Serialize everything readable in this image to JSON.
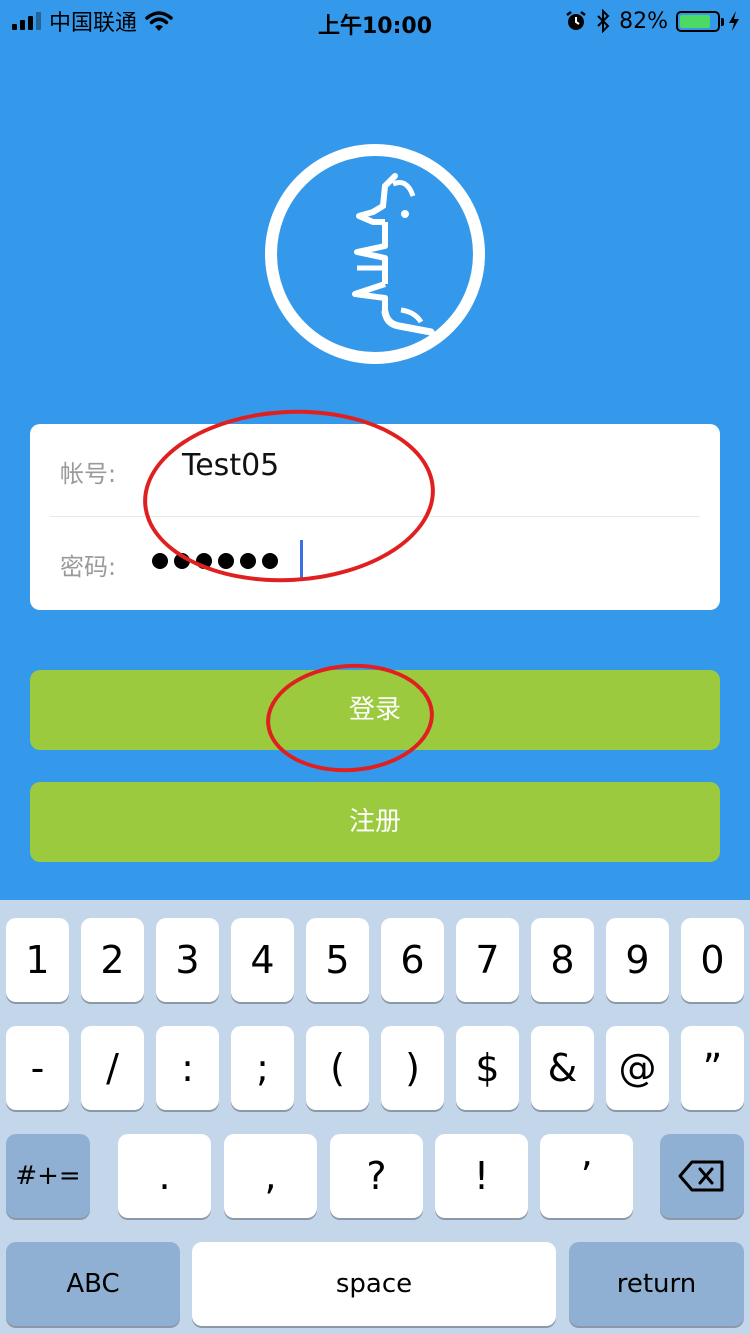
{
  "status_bar": {
    "carrier": "中国联通",
    "time": "上午10:00",
    "battery_percent": "82%",
    "battery_level": 0.82,
    "icons": [
      "signal-icon",
      "wifi-icon",
      "alarm-icon",
      "bluetooth-icon",
      "battery-icon",
      "charging-icon"
    ]
  },
  "logo": {
    "icon": "mongolian-script-logo"
  },
  "form": {
    "account_label": "帐号:",
    "account_value": "Test05",
    "password_label": "密码:",
    "password_length": 6
  },
  "buttons": {
    "login": "登录",
    "register": "注册"
  },
  "keyboard": {
    "row1": [
      "1",
      "2",
      "3",
      "4",
      "5",
      "6",
      "7",
      "8",
      "9",
      "0"
    ],
    "row2": [
      "-",
      "/",
      ":",
      ";",
      "(",
      ")",
      "$",
      "&",
      "@",
      "”"
    ],
    "row3": [
      ".",
      ",",
      "?",
      "!",
      "’"
    ],
    "more_symbols": "#+=",
    "abc": "ABC",
    "space": "space",
    "return": "return"
  },
  "colors": {
    "background": "#3599eb",
    "button": "#9bca3e",
    "annotation": "#e02020"
  }
}
